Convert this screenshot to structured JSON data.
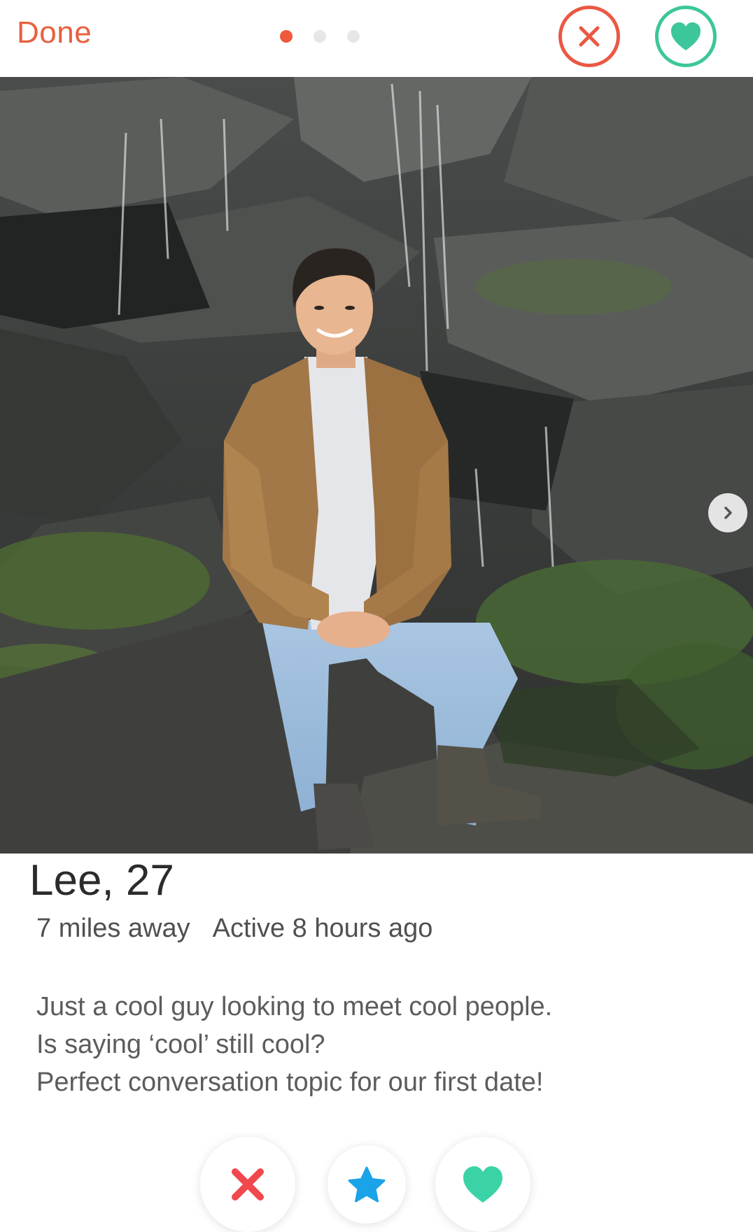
{
  "header": {
    "done_label": "Done",
    "photo_count": 3,
    "active_photo_index": 0
  },
  "profile": {
    "name_age": "Lee, 27",
    "distance": "7 miles away",
    "activity": "Active 8 hours ago",
    "bio_lines": [
      "Just a cool guy looking to meet cool people.",
      "Is saying ‘cool’ still cool?",
      "Perfect conversation topic for our first date!"
    ]
  },
  "icons": {
    "header_nope": "close-icon",
    "header_like": "heart-icon",
    "next_photo": "chevron-right-icon",
    "action_nope": "close-icon",
    "action_super": "star-icon",
    "action_like": "heart-icon"
  },
  "colors": {
    "brand_orange": "#e8603f",
    "nope_red": "#ea5844",
    "like_green": "#3cc69b",
    "super_blue": "#1aa3e8",
    "dot_active": "#ee5a3b",
    "dot_inactive": "#e6e6e6"
  }
}
